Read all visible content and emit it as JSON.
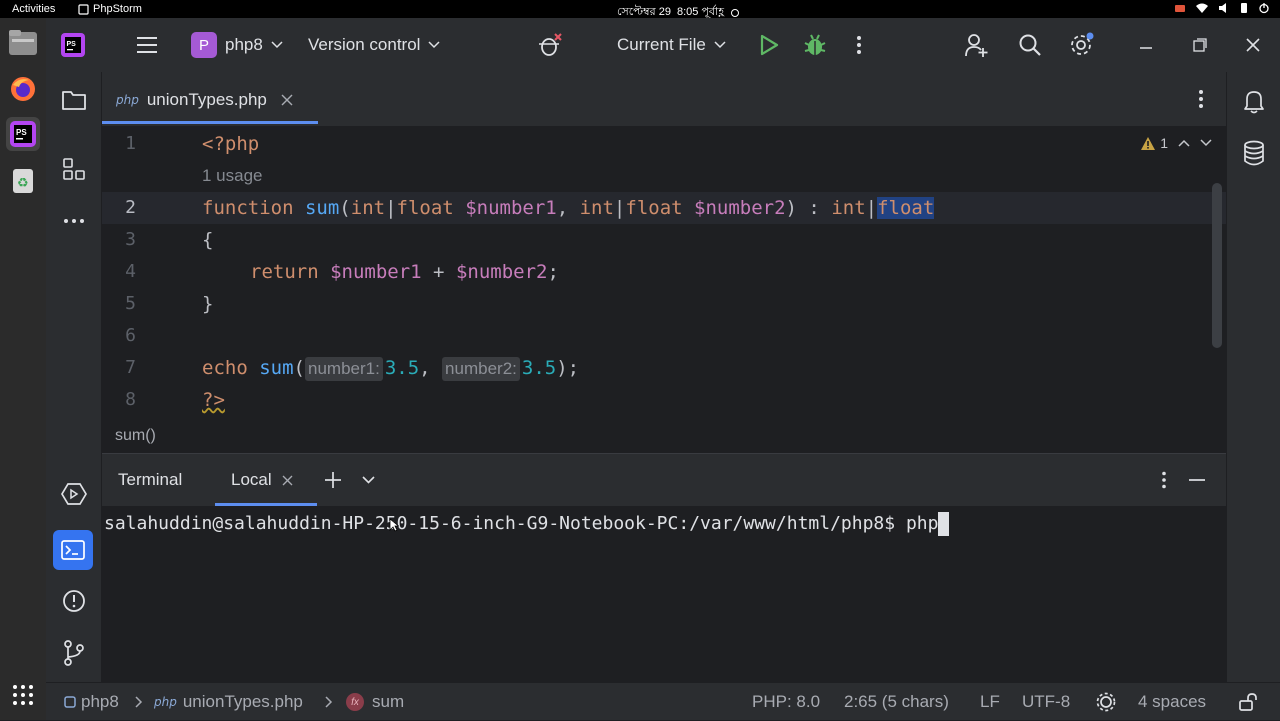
{
  "system": {
    "activities": "Activities",
    "app_name": "PhpStorm",
    "clock_date": "সেপ্টেম্বর 29",
    "clock_time": "8:05 পূর্বাহ্ণ"
  },
  "titlebar": {
    "project_badge": "P",
    "project": "php8",
    "vcs": "Version control",
    "run_config": "Current File"
  },
  "editor": {
    "tab": {
      "lang_tag": "php",
      "filename": "unionTypes.php"
    },
    "warnings_count": "1",
    "usage_hint": "1 usage",
    "line_numbers": [
      "1",
      "2",
      "3",
      "4",
      "5",
      "6",
      "7",
      "8"
    ],
    "code": {
      "l1": "<?php",
      "l2_function": "function",
      "l2_name": "sum",
      "l2_open": "(",
      "l2_int1": "int",
      "l2_pipe1": "|",
      "l2_float1": "float",
      "l2_var1": "$number1",
      "l2_comma": ", ",
      "l2_int2": "int",
      "l2_pipe2": "|",
      "l2_float2": "float",
      "l2_var2": "$number2",
      "l2_close": ") : ",
      "l2_int3": "int",
      "l2_pipe3": "|",
      "l2_float3": "float",
      "l3": "{",
      "l4_return": "return",
      "l4_var1": "$number1",
      "l4_plus": " + ",
      "l4_var2": "$number2",
      "l4_semi": ";",
      "l5": "}",
      "l7_echo": "echo",
      "l7_fn": "sum",
      "l7_open": "(",
      "l7_hint1": "number1:",
      "l7_val1": "3.5",
      "l7_comma": ", ",
      "l7_hint2": "number2:",
      "l7_val2": "3.5",
      "l7_close": ");",
      "l8": "?>"
    },
    "breadcrumb": "sum()"
  },
  "terminal": {
    "title": "Terminal",
    "tab": "Local",
    "prompt": "salahuddin@salahuddin-HP-250-15-6-inch-G9-Notebook-PC:/var/www/html/php8$ ",
    "input": "php"
  },
  "statusbar": {
    "project": "php8",
    "lang_tag": "php",
    "file": "unionTypes.php",
    "fx": "fx",
    "symbol": "sum",
    "php_version": "PHP: 8.0",
    "position": "2:65 (5 chars)",
    "line_sep": "LF",
    "encoding": "UTF-8",
    "indent": "4 spaces"
  },
  "colors": {
    "accent": "#5d8ef0",
    "keyword": "#cf8e6d",
    "function": "#56a8f5",
    "variable": "#c77dbb",
    "number": "#2aacb8",
    "run_green": "#5fb865"
  }
}
